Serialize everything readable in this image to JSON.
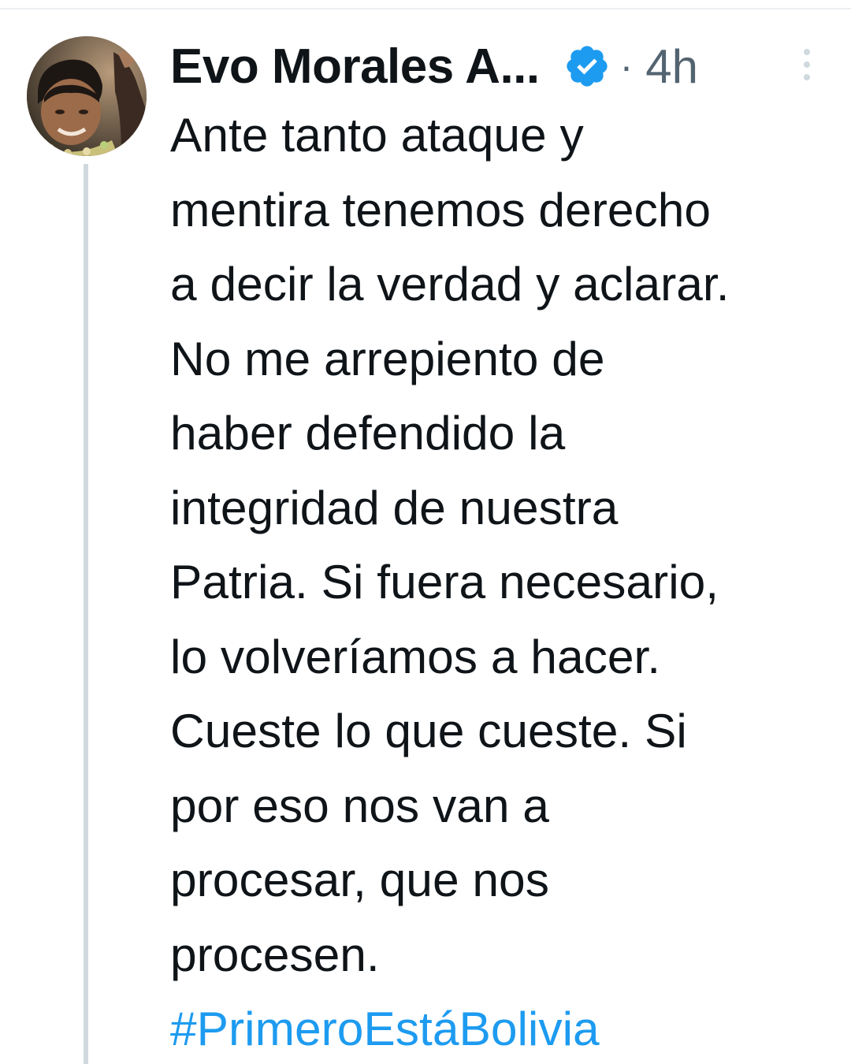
{
  "tweet": {
    "author_name": "Evo Morales A...",
    "verified_icon": "verified-badge-icon",
    "separator": "·",
    "timestamp": "4h",
    "more_icon": "more-vertical-icon",
    "lines": [
      "Ante tanto ataque y",
      "mentira tenemos derecho",
      "a decir la verdad y aclarar.",
      "No me arrepiento de",
      "haber defendido la",
      "integridad de nuestra",
      "Patria. Si fuera necesario,",
      "lo volveríamos a hacer.",
      "Cueste lo que cueste. Si",
      "por eso nos van a",
      "procesar, que nos",
      "procesen."
    ],
    "hashtag": "#PrimeroEstáBolivia"
  },
  "colors": {
    "text": "#0f1419",
    "secondary": "#536471",
    "link": "#1d9bf0",
    "thread_line": "#cfd9de"
  }
}
